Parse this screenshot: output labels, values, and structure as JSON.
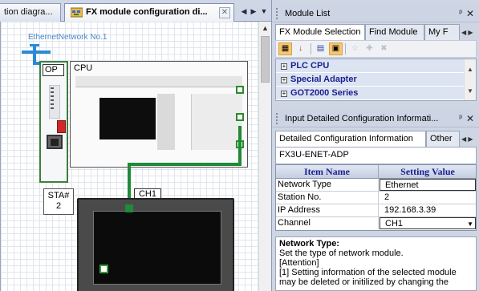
{
  "tabs": {
    "tab1_label": "tion diagra...",
    "tab2_label": "FX module configuration di...",
    "close_glyph": "✕",
    "prev_glyph": "◀",
    "next_glyph": "▶",
    "menu_glyph": "▼"
  },
  "diagram": {
    "network_label": "EthernetNetwork No.1",
    "op_label": "OP",
    "cpu_label": "CPU",
    "station_label": "STA#",
    "station_number": "2",
    "channel_label": "CH1",
    "colors": {
      "network": "#2a8ad8",
      "module_border": "#3d7f3d",
      "connection": "#1f8a3a"
    }
  },
  "module_list": {
    "title": "Module List",
    "pin_glyph": "ᵖ",
    "close_glyph": "✕",
    "tabs": [
      "FX Module Selection",
      "Find Module",
      "My F"
    ],
    "toolbar": [
      "grid-icon",
      "sort-icon",
      "filter-icon",
      "expand-icon",
      "star-icon",
      "add-icon",
      "delete-icon"
    ],
    "items": [
      "PLC CPU",
      "Special Adapter",
      "GOT2000 Series"
    ],
    "scroll_up": "▲",
    "scroll_down": "▼"
  },
  "config_panel": {
    "title": "Input Detailed Configuration Informati...",
    "tabs": [
      "Detailed Configuration Information",
      "Other"
    ],
    "module_name": "FX3U-ENET-ADP",
    "col_item": "Item Name",
    "col_value": "Setting Value",
    "rows": [
      {
        "name": "Network Type",
        "value": "Ethernet"
      },
      {
        "name": "Station No.",
        "value": "2"
      },
      {
        "name": "IP Address",
        "value": "192.168.3.39"
      },
      {
        "name": "Channel",
        "value": "CH1"
      }
    ]
  },
  "description": {
    "title": "Network Type:",
    "line1": "Set the type of network module.",
    "line2": "[Attention]",
    "line3": "[1] Setting information of the selected module",
    "line4": "may be deleted or initilized by changing the"
  }
}
